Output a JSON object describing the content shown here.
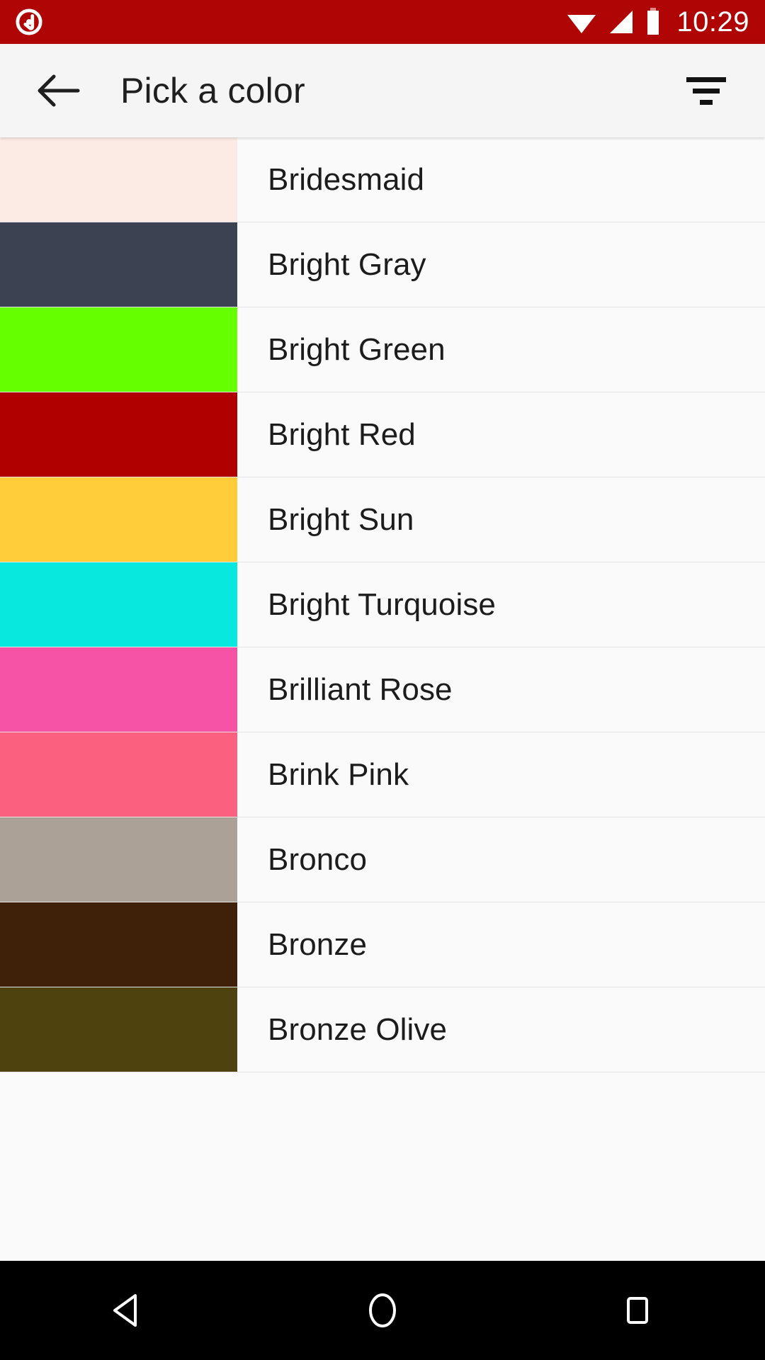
{
  "status_bar": {
    "background": "#b00505",
    "time": "10:29",
    "notification_icon": "app-notification-icon",
    "icons": [
      "wifi-icon",
      "cellular-signal-icon",
      "battery-icon"
    ]
  },
  "app_bar": {
    "background": "#f5f5f5",
    "back_icon": "back-arrow-icon",
    "title": "Pick a color",
    "filter_icon": "filter-sort-icon"
  },
  "list": {
    "rows": [
      {
        "name": "Bridesmaid",
        "swatch": "#fceae4"
      },
      {
        "name": "Bright Gray",
        "swatch": "#3c4252"
      },
      {
        "name": "Bright Green",
        "swatch": "#66ff00"
      },
      {
        "name": "Bright Red",
        "swatch": "#b10000"
      },
      {
        "name": "Bright Sun",
        "swatch": "#fecd39"
      },
      {
        "name": "Bright Turquoise",
        "swatch": "#08e8de"
      },
      {
        "name": "Brilliant Rose",
        "swatch": "#f653a6"
      },
      {
        "name": "Brink Pink",
        "swatch": "#fb607f"
      },
      {
        "name": "Bronco",
        "swatch": "#aba196"
      },
      {
        "name": "Bronze",
        "swatch": "#3f2109"
      },
      {
        "name": "Bronze Olive",
        "swatch": "#4e420e"
      }
    ]
  },
  "nav_bar": {
    "background": "#000000",
    "buttons": [
      {
        "name": "back-nav-button",
        "icon": "triangle-back-icon"
      },
      {
        "name": "home-nav-button",
        "icon": "circle-home-icon"
      },
      {
        "name": "recents-nav-button",
        "icon": "square-recents-icon"
      }
    ]
  }
}
